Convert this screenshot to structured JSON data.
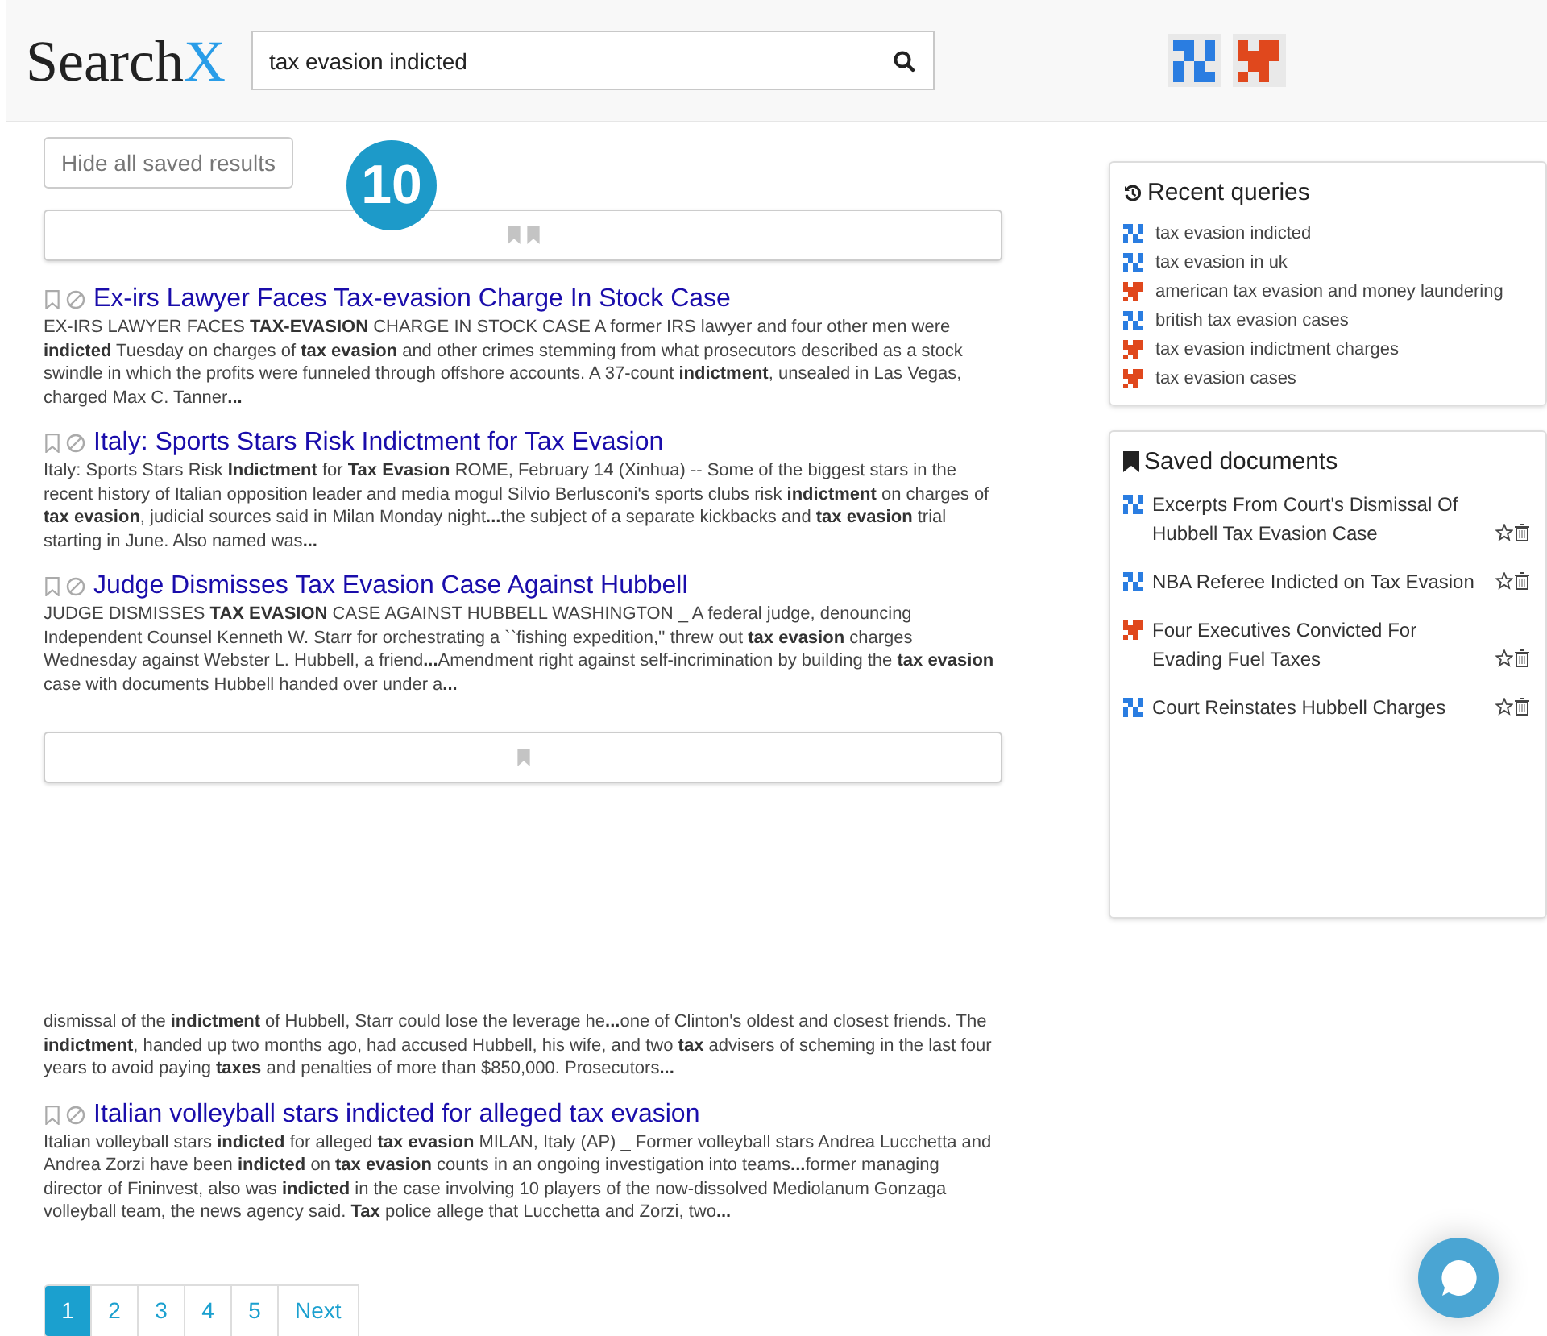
{
  "header": {
    "logo_text": "Search",
    "logo_accent": "X",
    "search_value": "tax evasion indicted",
    "sources": [
      {
        "color": "#2a7de1"
      },
      {
        "color": "#e0481d"
      }
    ]
  },
  "hide_button": "Hide all saved results",
  "badge": "10",
  "results": [
    {
      "kind": "collapsed",
      "markers": [
        {
          "kind": "bookmark"
        },
        {
          "kind": "bookmark"
        }
      ]
    },
    {
      "kind": "result",
      "title": "Ex-irs Lawyer Faces Tax-evasion Charge In Stock Case",
      "snippet": "EX-IRS LAWYER FACES **TAX-EVASION** CHARGE IN STOCK CASE A former IRS lawyer and four other men were **indicted** Tuesday on charges of **tax evasion** and other crimes stemming from what prosecutors described as a stock swindle in which the profits were funneled through offshore accounts. A 37-count **indictment**, unsealed in Las Vegas, charged Max C. Tanner**...**"
    },
    {
      "kind": "result",
      "title": "Italy: Sports Stars Risk Indictment for Tax Evasion",
      "snippet": "Italy: Sports Stars Risk **Indictment** for **Tax Evasion** ROME, February 14 (Xinhua) -- Some of the biggest stars in the recent history of Italian opposition leader and media mogul Silvio Berlusconi's sports clubs risk **indictment** on charges of **tax evasion**, judicial sources said in Milan Monday night**...**the subject of a separate kickbacks and **tax evasion** trial starting in June. Also named was**...**"
    },
    {
      "kind": "result",
      "title": "Judge Dismisses Tax Evasion Case Against Hubbell",
      "snippet": "JUDGE DISMISSES **TAX EVASION** CASE AGAINST HUBBELL WASHINGTON _ A federal judge, denouncing Independent Counsel Kenneth W. Starr for orchestrating a ``fishing expedition,'' threw out **tax evasion** charges Wednesday against Webster L. Hubbell, a friend**...**Amendment right against self-incrimination by building the **tax evasion** case with documents Hubbell handed over under a**...**"
    },
    {
      "kind": "collapsed",
      "markers": [
        {
          "kind": "bookmark"
        }
      ]
    },
    {
      "kind": "fragment",
      "snippet": "dismissal of the **indictment** of Hubbell, Starr could lose the leverage he**...**one of Clinton's oldest and closest friends. The **indictment**, handed up two months ago, had accused Hubbell, his wife, and two **tax** advisers of scheming in the last four years to avoid paying **taxes** and penalties of more than $850,000. Prosecutors**...**"
    },
    {
      "kind": "result",
      "title": "Italian volleyball stars indicted for alleged tax evasion",
      "snippet": "Italian volleyball stars **indicted** for alleged **tax evasion** MILAN, Italy (AP) _ Former volleyball stars Andrea Lucchetta and Andrea Zorzi have been **indicted** on **tax evasion** counts in an ongoing investigation into teams**...**former managing director of Fininvest, also was **indicted** in the case involving 10 players of the now-dissolved Mediolanum Gonzaga volleyball team, the news agency said. **Tax** police allege that Lucchetta and Zorzi, two**...**"
    }
  ],
  "pagination": [
    {
      "label": "1",
      "selected": true
    },
    {
      "label": "2",
      "selected": false
    },
    {
      "label": "3",
      "selected": false
    },
    {
      "label": "4",
      "selected": false
    },
    {
      "label": "5",
      "selected": false
    },
    {
      "label": "Next",
      "selected": false
    }
  ],
  "recent_queries": {
    "title": "Recent queries",
    "items": [
      {
        "text": "tax evasion indicted",
        "color": "#2a7de1"
      },
      {
        "text": "tax evasion in uk",
        "color": "#2a7de1"
      },
      {
        "text": "american tax evasion and money laundering",
        "color": "#e0481d"
      },
      {
        "text": "british tax evasion cases",
        "color": "#2a7de1"
      },
      {
        "text": "tax evasion indictment charges",
        "color": "#e0481d"
      },
      {
        "text": "tax evasion cases",
        "color": "#e0481d"
      }
    ]
  },
  "saved_documents": {
    "title": "Saved documents",
    "items": [
      {
        "text": "Excerpts From Court's Dismissal Of Hubbell Tax Evasion Case",
        "color": "#2a7de1"
      },
      {
        "text": "NBA Referee Indicted on Tax Evasion",
        "color": "#2a7de1"
      },
      {
        "text": "Four Executives Convicted For Evading Fuel Taxes",
        "color": "#e0481d"
      },
      {
        "text": "Court Reinstates Hubbell Charges",
        "color": "#2a7de1"
      }
    ]
  }
}
